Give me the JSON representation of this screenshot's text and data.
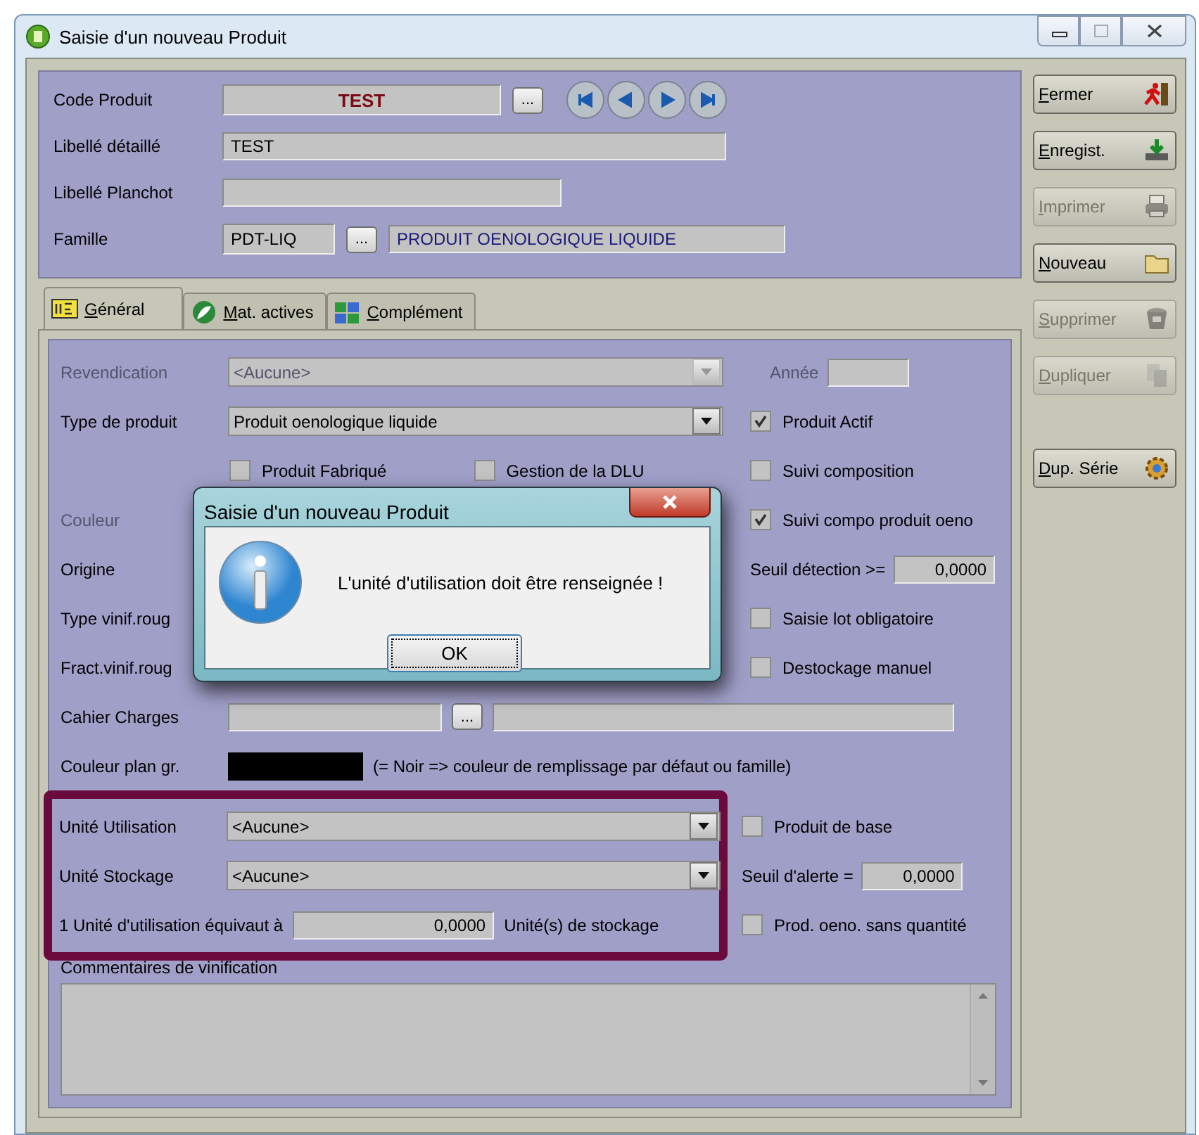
{
  "window": {
    "title": "Saisie d'un nouveau Produit"
  },
  "header": {
    "code_produit": {
      "label": "Code Produit",
      "value": "TEST",
      "browse": "..."
    },
    "libelle_detaille": {
      "label": "Libellé détaillé",
      "value": "TEST"
    },
    "libelle_planchot": {
      "label": "Libellé Planchot"
    },
    "famille": {
      "label": "Famille",
      "code": "PDT-LIQ",
      "browse": "...",
      "description": "PRODUIT OENOLOGIQUE LIQUIDE"
    }
  },
  "side_buttons": [
    {
      "label": "Fermer",
      "disabled": false
    },
    {
      "label": "Enregist.",
      "disabled": false
    },
    {
      "label": "Imprimer",
      "disabled": true
    },
    {
      "label": "Nouveau",
      "disabled": false
    },
    {
      "label": "Supprimer",
      "disabled": true
    },
    {
      "label": "Dupliquer",
      "disabled": true
    },
    {
      "label": "Dup. Série",
      "disabled": false
    }
  ],
  "tabs": [
    {
      "label": "Général",
      "selected": true
    },
    {
      "label": "Mat. actives",
      "selected": false
    },
    {
      "label": "Complément",
      "selected": false
    }
  ],
  "general": {
    "rows": [
      {
        "left": {
          "kind": "combo",
          "label": "Revendication",
          "value": "<Aucune>",
          "disabled": true
        },
        "right": {
          "kind": "field",
          "label": "Année",
          "disabled": true
        },
        "highlighted": false
      },
      {
        "left": {
          "kind": "combo",
          "label": "Type de produit",
          "value": "Produit oenologique liquide",
          "disabled": false
        },
        "right": {
          "kind": "check",
          "label": "Produit Actif",
          "checked": true
        },
        "highlighted": false
      },
      {
        "left": {
          "kind": "checks",
          "items": [
            {
              "label": "Produit Fabriqué",
              "checked": false
            },
            {
              "label": "Gestion de la DLU",
              "checked": false
            }
          ]
        },
        "right": {
          "kind": "check",
          "label": "Suivi composition",
          "checked": false
        },
        "highlighted": false
      },
      {
        "left": {
          "kind": "label",
          "label": "Couleur",
          "disabled": true
        },
        "right": {
          "kind": "check",
          "label": "Suivi compo produit oeno",
          "checked": true
        },
        "highlighted": false
      },
      {
        "left": {
          "kind": "label",
          "label": "Origine",
          "disabled": false
        },
        "right": {
          "kind": "field",
          "label": "Seuil détection >=",
          "value": "0,0000",
          "disabled": false
        },
        "highlighted": false
      },
      {
        "left": {
          "kind": "label",
          "label": "Type vinif.roug",
          "disabled": false
        },
        "right": {
          "kind": "check",
          "label": "Saisie lot obligatoire",
          "checked": false
        },
        "highlighted": false
      },
      {
        "left": {
          "kind": "label",
          "label": "Fract.vinif.roug",
          "disabled": false
        },
        "right": {
          "kind": "check",
          "label": "Destockage manuel",
          "checked": false
        },
        "highlighted": false
      },
      {
        "left": {
          "kind": "lookup",
          "label": "Cahier Charges",
          "browse": "..."
        },
        "highlighted": false
      },
      {
        "left": {
          "kind": "swatch",
          "label": "Couleur plan gr.",
          "note": "(= Noir => couleur de remplissage par défaut ou famille)"
        },
        "highlighted": false
      },
      {
        "left": {
          "kind": "combo",
          "label": "Unité Utilisation",
          "value": "<Aucune>",
          "disabled": false
        },
        "right": {
          "kind": "check",
          "label": "Produit de base",
          "checked": false
        },
        "highlighted": true
      },
      {
        "left": {
          "kind": "combo",
          "label": "Unité Stockage",
          "value": "<Aucune>",
          "disabled": false
        },
        "right": {
          "kind": "field",
          "label": "Seuil d'alerte =",
          "value": "0,0000",
          "disabled": false
        },
        "highlighted": true
      },
      {
        "left": {
          "kind": "equiv",
          "label": "1 Unité d'utilisation équivaut à",
          "value": "0,0000",
          "unit": "Unité(s) de stockage"
        },
        "right": {
          "kind": "check",
          "label": "Prod. oeno. sans quantité",
          "checked": false
        },
        "highlighted": true
      }
    ],
    "comments": {
      "label": "Commentaires de vinification"
    }
  },
  "dialog": {
    "title": "Saisie d'un nouveau Produit",
    "message": "L'unité d'utilisation doit être renseignée !",
    "button": "OK"
  }
}
